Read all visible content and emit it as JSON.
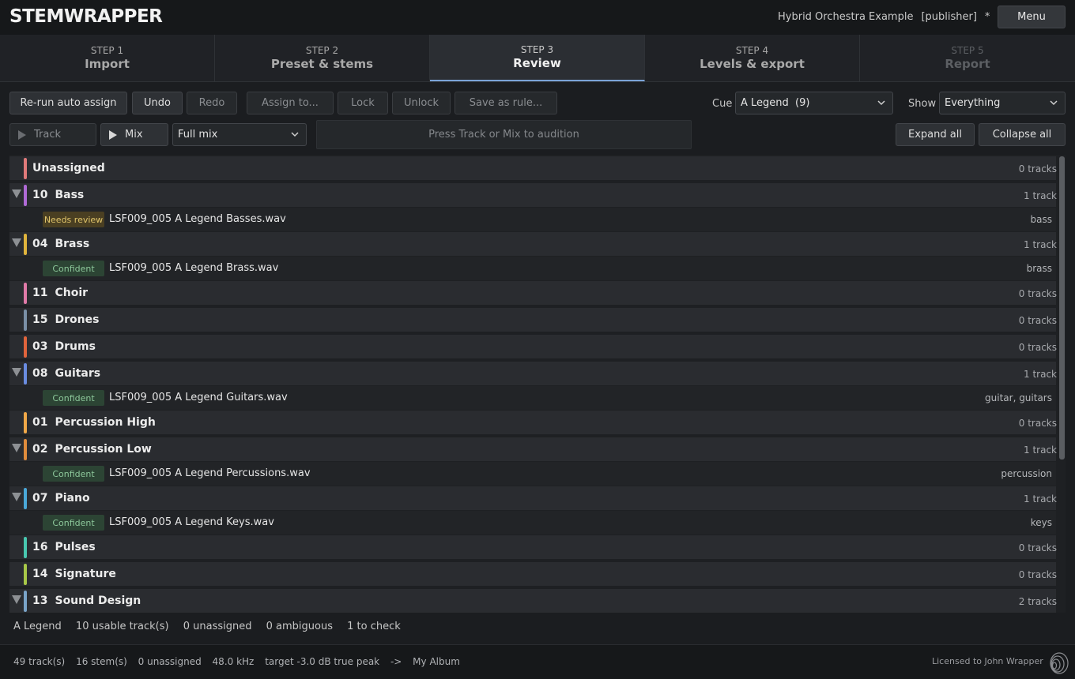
{
  "app": {
    "logo": "STEMWRAPPER",
    "project_name": "Hybrid Orchestra Example",
    "project_role": "[publisher]",
    "dirty_marker": "*",
    "menu_label": "Menu"
  },
  "steps": [
    {
      "num": "STEP 1",
      "name": "Import",
      "state": "normal"
    },
    {
      "num": "STEP 2",
      "name": "Preset & stems",
      "state": "normal"
    },
    {
      "num": "STEP 3",
      "name": "Review",
      "state": "active"
    },
    {
      "num": "STEP 4",
      "name": "Levels & export",
      "state": "normal"
    },
    {
      "num": "STEP 5",
      "name": "Report",
      "state": "disabled"
    }
  ],
  "toolbar": {
    "rerun": "Re-run auto assign",
    "undo": "Undo",
    "redo": "Redo",
    "assign": "Assign to...",
    "lock": "Lock",
    "unlock": "Unlock",
    "save_rule": "Save as rule...",
    "cue_label": "Cue",
    "cue_value": "A Legend  (9)",
    "show_label": "Show",
    "show_value": "Everything"
  },
  "audition": {
    "track": "Track",
    "mix": "Mix",
    "mix_select": "Full mix",
    "hint": "Press Track or Mix to audition",
    "expand_all": "Expand all",
    "collapse_all": "Collapse all"
  },
  "groups": [
    {
      "code": "",
      "name": "Unassigned",
      "count": "0 tracks",
      "color": "#e07a7a",
      "expanded": false,
      "tracks": []
    },
    {
      "code": "10",
      "name": "Bass",
      "count": "1 track",
      "color": "#b06ad6",
      "expanded": true,
      "tracks": [
        {
          "status": "Needs review",
          "kind": "review",
          "file": "LSF009_005 A Legend Basses.wav",
          "tags": "bass"
        }
      ]
    },
    {
      "code": "04",
      "name": "Brass",
      "count": "1 track",
      "color": "#e0b43c",
      "expanded": true,
      "tracks": [
        {
          "status": "Confident",
          "kind": "confident",
          "file": "LSF009_005 A Legend Brass.wav",
          "tags": "brass"
        }
      ]
    },
    {
      "code": "11",
      "name": "Choir",
      "count": "0 tracks",
      "color": "#e07aa8",
      "expanded": false,
      "tracks": []
    },
    {
      "code": "15",
      "name": "Drones",
      "count": "0 tracks",
      "color": "#7a8fa6",
      "expanded": false,
      "tracks": []
    },
    {
      "code": "03",
      "name": "Drums",
      "count": "0 tracks",
      "color": "#e0643c",
      "expanded": false,
      "tracks": []
    },
    {
      "code": "08",
      "name": "Guitars",
      "count": "1 track",
      "color": "#6a8ce0",
      "expanded": true,
      "tracks": [
        {
          "status": "Confident",
          "kind": "confident",
          "file": "LSF009_005 A Legend Guitars.wav",
          "tags": "guitar, guitars"
        }
      ]
    },
    {
      "code": "01",
      "name": "Percussion High",
      "count": "0 tracks",
      "color": "#f0a848",
      "expanded": false,
      "tracks": []
    },
    {
      "code": "02",
      "name": "Percussion Low",
      "count": "1 track",
      "color": "#e08c3c",
      "expanded": true,
      "tracks": [
        {
          "status": "Confident",
          "kind": "confident",
          "file": "LSF009_005 A Legend Percussions.wav",
          "tags": "percussion"
        }
      ]
    },
    {
      "code": "07",
      "name": "Piano",
      "count": "1 track",
      "color": "#4aa8d8",
      "expanded": true,
      "tracks": [
        {
          "status": "Confident",
          "kind": "confident",
          "file": "LSF009_005 A Legend Keys.wav",
          "tags": "keys"
        }
      ]
    },
    {
      "code": "16",
      "name": "Pulses",
      "count": "0 tracks",
      "color": "#48c8b0",
      "expanded": false,
      "tracks": []
    },
    {
      "code": "14",
      "name": "Signature",
      "count": "0 tracks",
      "color": "#a8c848",
      "expanded": false,
      "tracks": []
    },
    {
      "code": "13",
      "name": "Sound Design",
      "count": "2 tracks",
      "color": "#7aa4c8",
      "expanded": true,
      "tracks": []
    }
  ],
  "summary": {
    "cue": "A Legend",
    "usable": "10 usable track(s)",
    "unassigned": "0 unassigned",
    "ambiguous": "0 ambiguous",
    "to_check": "1 to check"
  },
  "status": {
    "tracks": "49 track(s)",
    "stems": "16 stem(s)",
    "unassigned": "0 unassigned",
    "rate": "48.0 kHz",
    "target": "target -3.0 dB true peak",
    "arrow": "->",
    "album": "My Album",
    "license": "Licensed to John Wrapper"
  }
}
